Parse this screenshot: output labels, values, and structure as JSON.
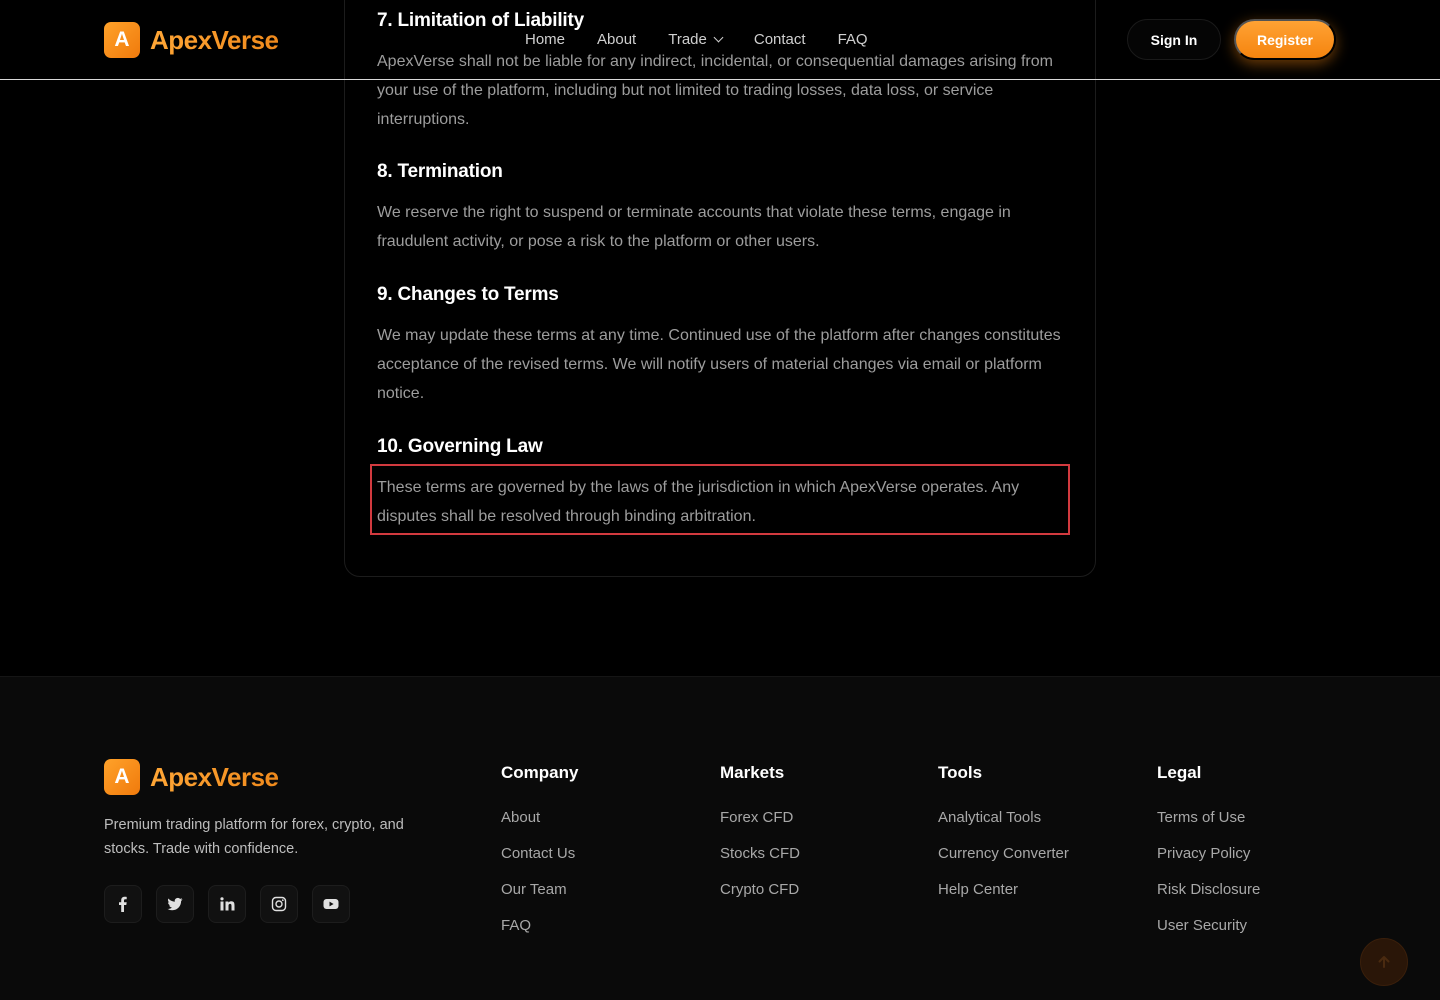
{
  "brand": {
    "mark": "A",
    "name": "ApexVerse",
    "accent": "#f5840f"
  },
  "header": {
    "nav": [
      {
        "label": "Home"
      },
      {
        "label": "About"
      },
      {
        "label": "Trade",
        "has_dropdown": true
      },
      {
        "label": "Contact"
      },
      {
        "label": "FAQ"
      }
    ],
    "signin_label": "Sign In",
    "register_label": "Register"
  },
  "terms": {
    "sections": [
      {
        "title": "7. Limitation of Liability",
        "body": "ApexVerse shall not be liable for any indirect, incidental, or consequential damages arising from your use of the platform, including but not limited to trading losses, data loss, or service interruptions."
      },
      {
        "title": "8. Termination",
        "body": "We reserve the right to suspend or terminate accounts that violate these terms, engage in fraudulent activity, or pose a risk to the platform or other users."
      },
      {
        "title": "9. Changes to Terms",
        "body": "We may update these terms at any time. Continued use of the platform after changes constitutes acceptance of the revised terms. We will notify users of material changes via email or platform notice."
      },
      {
        "title": "10. Governing Law",
        "body": "These terms are governed by the laws of the jurisdiction in which ApexVerse operates. Any disputes shall be resolved through binding arbitration."
      }
    ],
    "highlight_color": "#d23a3f"
  },
  "footer": {
    "description": "Premium trading platform for forex, crypto, and stocks. Trade with confidence.",
    "socials": [
      "facebook-icon",
      "twitter-icon",
      "linkedin-icon",
      "instagram-icon",
      "youtube-icon"
    ],
    "columns": [
      {
        "heading": "Company",
        "links": [
          "About",
          "Contact Us",
          "Our Team",
          "FAQ"
        ]
      },
      {
        "heading": "Markets",
        "links": [
          "Forex CFD",
          "Stocks CFD",
          "Crypto CFD"
        ]
      },
      {
        "heading": "Tools",
        "links": [
          "Analytical Tools",
          "Currency Converter",
          "Help Center"
        ]
      },
      {
        "heading": "Legal",
        "links": [
          "Terms of Use",
          "Privacy Policy",
          "Risk Disclosure",
          "User Security"
        ]
      }
    ]
  }
}
